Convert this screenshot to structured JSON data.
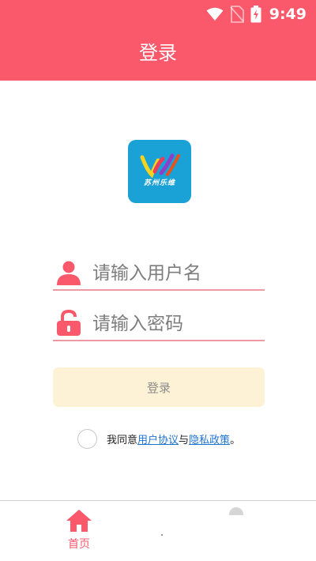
{
  "status_bar": {
    "time": "9:49",
    "icons": [
      "wifi-icon",
      "no-sim-icon",
      "battery-charging-icon"
    ]
  },
  "header": {
    "title": "登录",
    "background_color": "#f9596a"
  },
  "logo": {
    "text": "苏州乐维",
    "background_color": "#1aa1d6"
  },
  "form": {
    "username_placeholder": "请输入用户名",
    "password_placeholder": "请输入密码",
    "username_icon": "user-icon",
    "password_icon": "unlock-icon",
    "login_button_label": "登录"
  },
  "agreement": {
    "prefix": "我同意",
    "user_agreement_link": "用户协议",
    "connector": "与",
    "privacy_policy_link": "隐私政策",
    "suffix": "。",
    "checked": false
  },
  "tabbar": {
    "home_label": "首页",
    "home_icon": "home-icon",
    "accent_color": "#f9596a"
  }
}
